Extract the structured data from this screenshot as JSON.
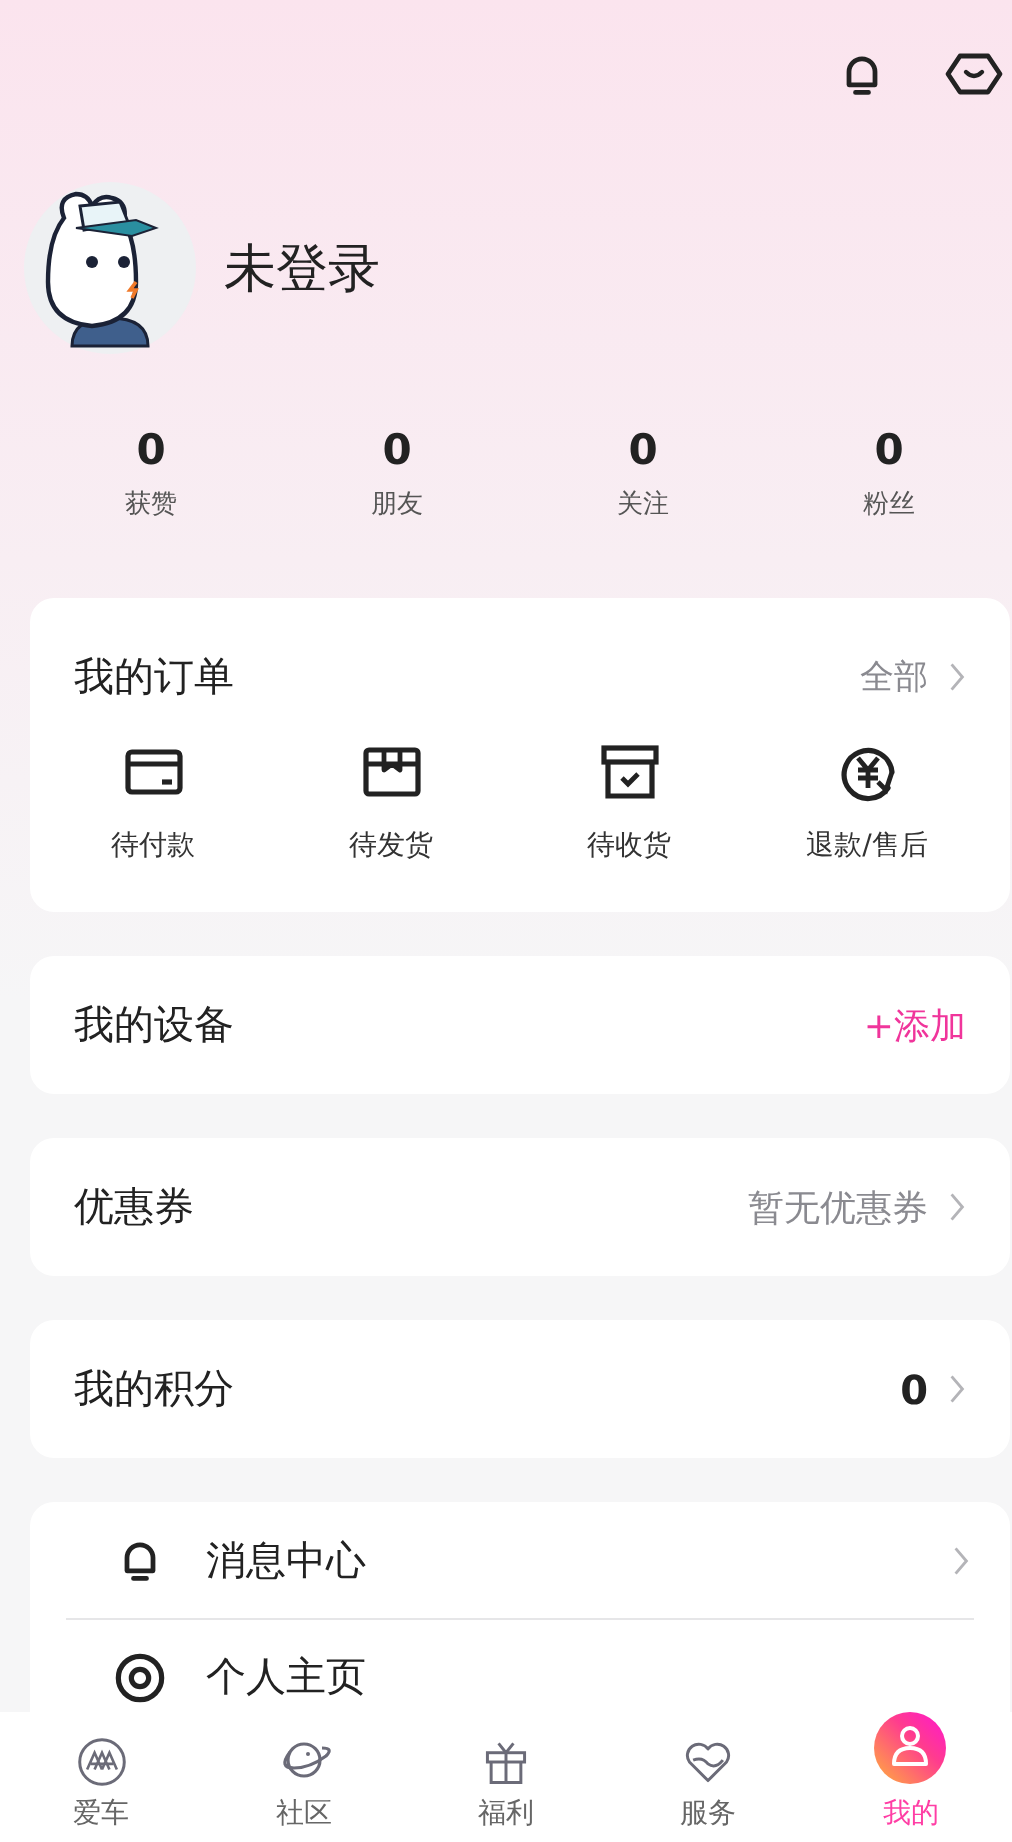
{
  "profile": {
    "name": "未登录"
  },
  "stats": [
    {
      "value": "0",
      "label": "获赞"
    },
    {
      "value": "0",
      "label": "朋友"
    },
    {
      "value": "0",
      "label": "关注"
    },
    {
      "value": "0",
      "label": "粉丝"
    }
  ],
  "orders": {
    "title": "我的订单",
    "link": "全部",
    "items": [
      {
        "kind": "wallet",
        "label": "待付款"
      },
      {
        "kind": "box",
        "label": "待发货"
      },
      {
        "kind": "archive",
        "label": "待收货"
      },
      {
        "kind": "refund",
        "label": "退款/售后"
      }
    ]
  },
  "devices": {
    "title": "我的设备",
    "action": "+添加"
  },
  "coupons": {
    "title": "优惠券",
    "value": "暂无优惠券"
  },
  "points": {
    "title": "我的积分",
    "value": "0"
  },
  "menu": [
    {
      "kind": "bell",
      "label": "消息中心"
    },
    {
      "kind": "target",
      "label": "个人主页"
    }
  ],
  "tabs": [
    {
      "kind": "car",
      "label": "爱车",
      "selected": false
    },
    {
      "kind": "planet",
      "label": "社区",
      "selected": false
    },
    {
      "kind": "gift",
      "label": "福利",
      "selected": false
    },
    {
      "kind": "heart",
      "label": "服务",
      "selected": false
    },
    {
      "kind": "person",
      "label": "我的",
      "selected": true
    }
  ]
}
